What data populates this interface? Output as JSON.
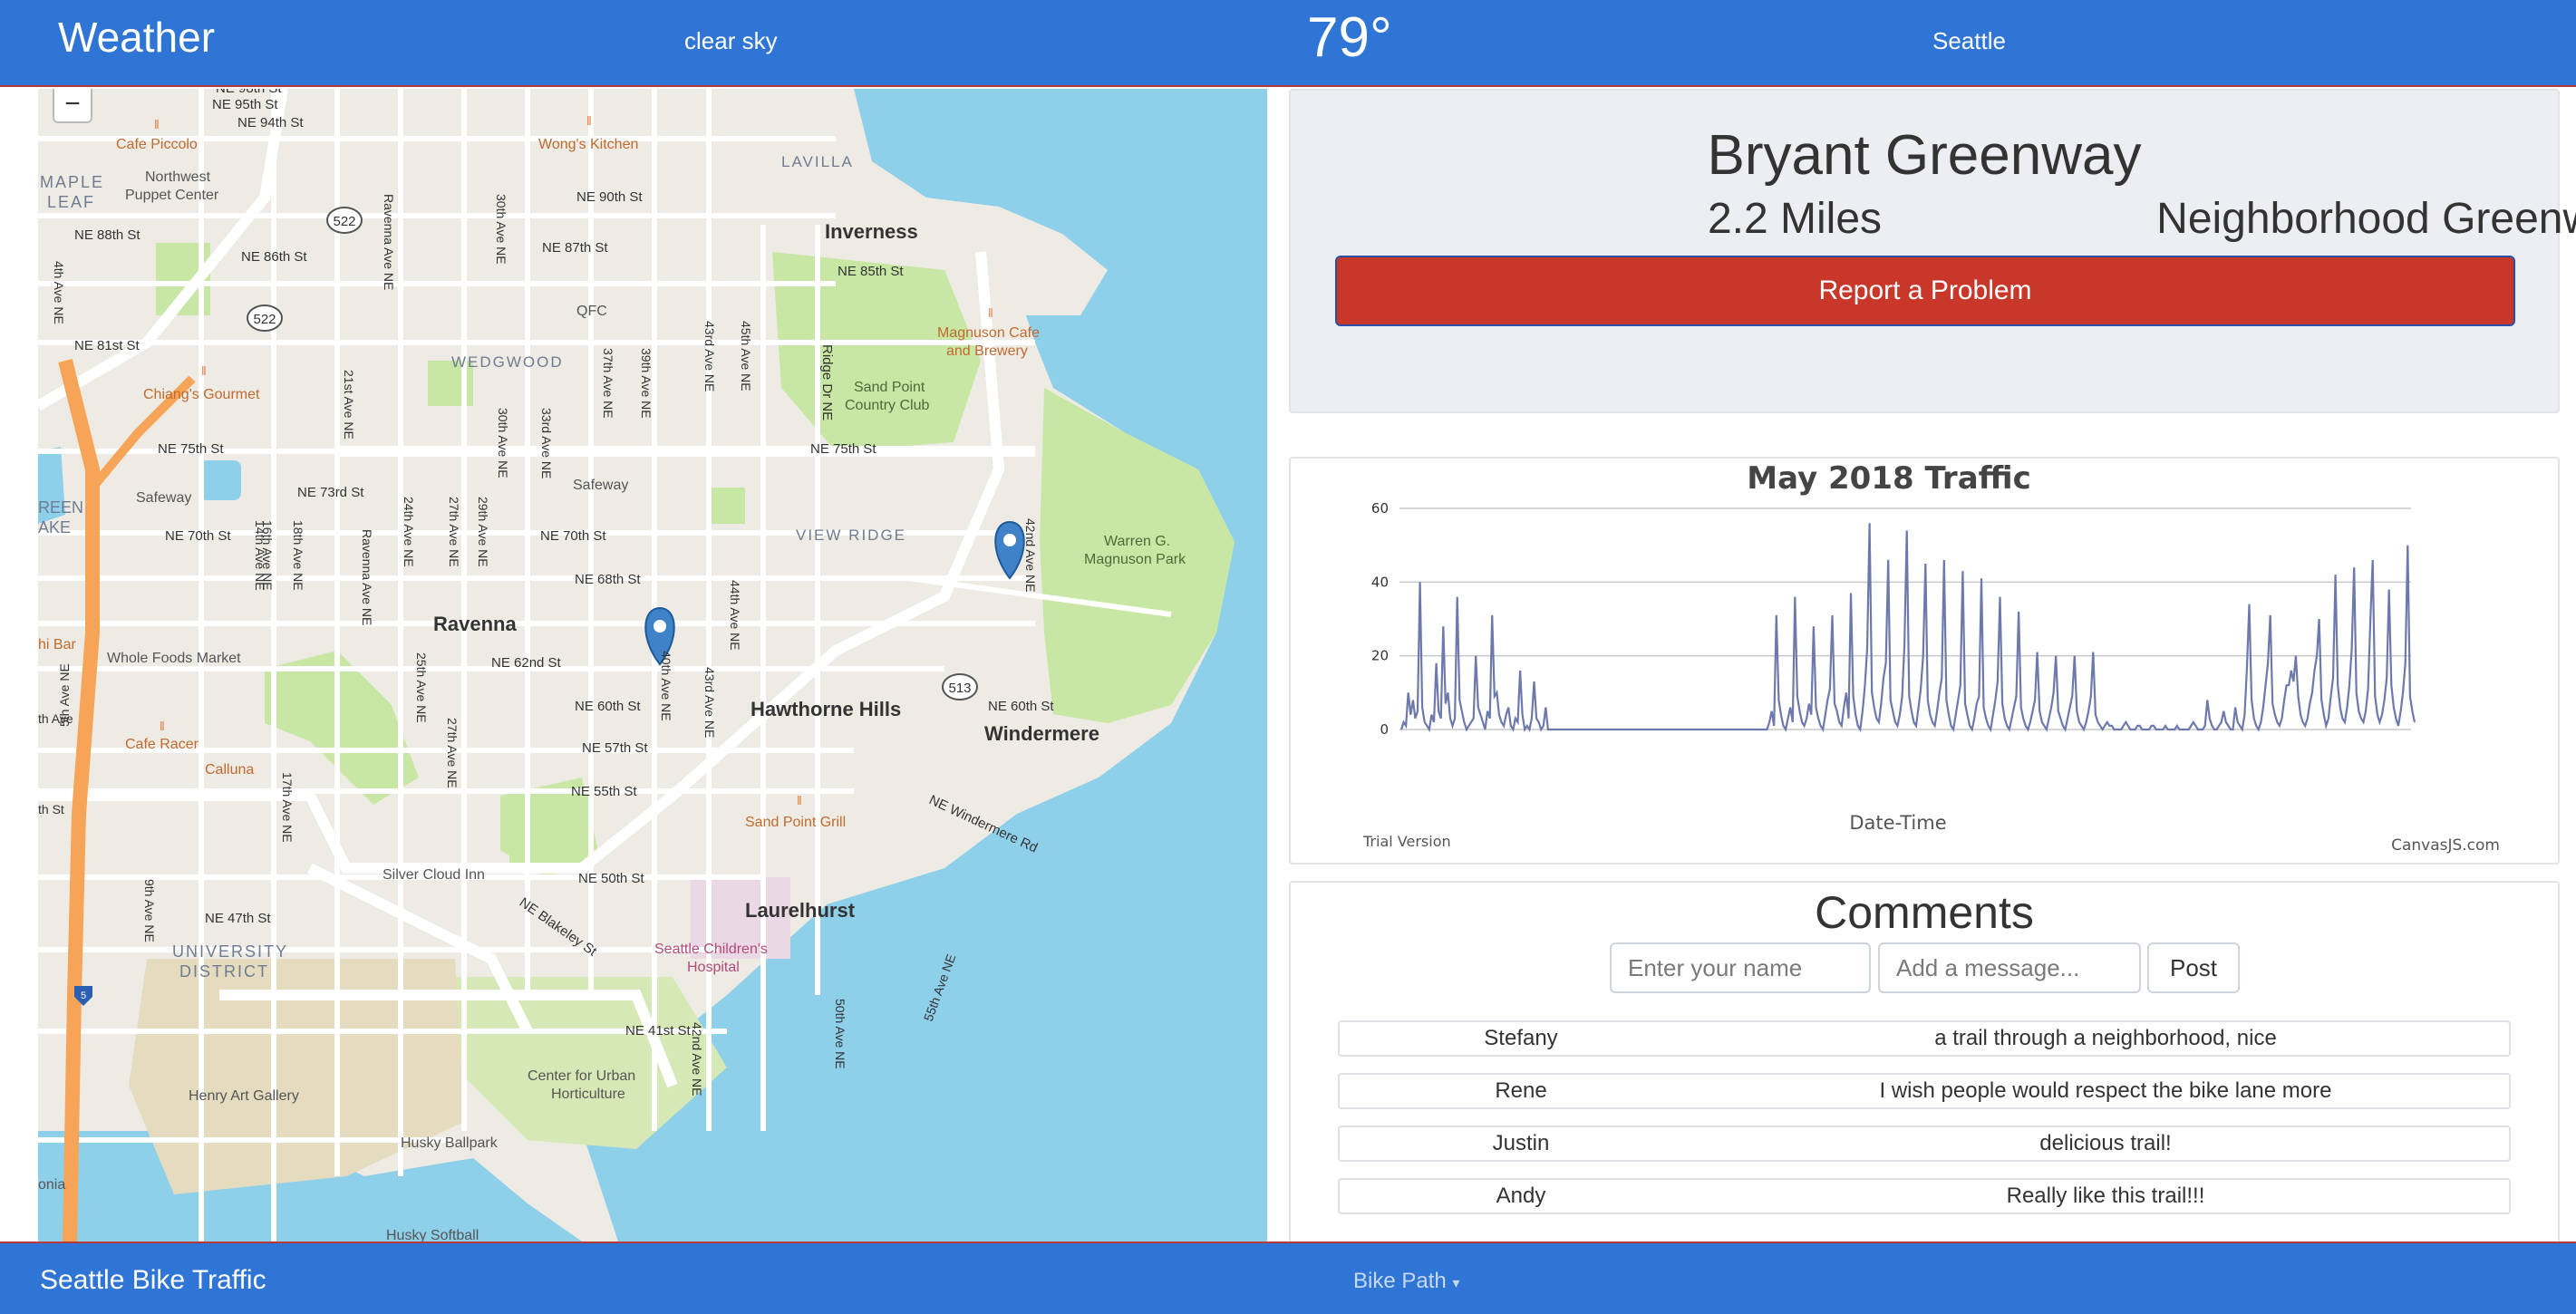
{
  "header": {
    "brand": "Weather",
    "condition": "clear sky",
    "temperature": "79°",
    "city": "Seattle"
  },
  "map": {
    "zoom_out_label": "−",
    "labels": {
      "inverness": "Inverness",
      "ravenna": "Ravenna",
      "hawthorne": "Hawthorne Hills",
      "windermere": "Windermere",
      "laurelhurst": "Laurelhurst",
      "wedgwood": "WEDGWOOD",
      "view_ridge": "VIEW RIDGE",
      "university_district": "UNIVERSITY\nDISTRICT",
      "university_1": "UNIVERSITY",
      "university_2": "DISTRICT",
      "maple_leaf_1": "MAPLE",
      "maple_leaf_2": "LEAF",
      "laville": "LAVILLA",
      "green_lake_1": "REEN",
      "green_lake_2": "AKE",
      "sand_point_1": "Sand Point",
      "sand_point_2": "Country Club",
      "magnuson_1": "Warren G.",
      "magnuson_2": "Magnuson Park",
      "magnuson_cafe_1": "Magnuson Cafe",
      "magnuson_cafe_2": "and Brewery",
      "wongs": "Wong's Kitchen",
      "cafe_piccolo": "Cafe Piccolo",
      "northwest_puppet_1": "Northwest",
      "northwest_puppet_2": "Puppet Center",
      "chiangs": "Chiang's Gourmet",
      "safeway1": "Safeway",
      "safeway2": "Safeway",
      "qfc": "QFC",
      "whole_foods": "Whole Foods Market",
      "cafe_racer": "Cafe Racer",
      "calluna": "Calluna",
      "sand_point_grill": "Sand Point Grill",
      "silver_cloud": "Silver Cloud Inn",
      "childrens_1": "Seattle Children's",
      "childrens_2": "Hospital",
      "urban_hort_1": "Center for Urban",
      "urban_hort_2": "Horticulture",
      "henry_art": "Henry Art Gallery",
      "husky_ballpark": "Husky Ballpark",
      "husky_softball": "Husky Softball",
      "hi_bar": "hi Bar",
      "onia": "onia",
      "ne98": "NE 98th St",
      "ne95": "NE 95th St",
      "ne94": "NE 94th St",
      "ne90": "NE 90th St",
      "ne88": "NE 88th St",
      "ne87": "NE 87th St",
      "ne86": "NE 86th St",
      "ne85": "NE 85th St",
      "ne81": "NE 81st St",
      "ne75a": "NE 75th St",
      "ne75b": "NE 75th St",
      "ne73": "NE 73rd St",
      "ne70a": "NE 70th St",
      "ne70b": "NE 70th St",
      "ne68": "NE 68th St",
      "ne62": "NE 62nd St",
      "ne60a": "NE 60th St",
      "ne60b": "NE 60th St",
      "ne57": "NE 57th St",
      "ne55": "NE 55th St",
      "ne50": "NE 50th St",
      "ne47": "NE 47th St",
      "ne41": "NE 41st St",
      "blakeley": "NE Blakeley St",
      "windermere_rd": "NE Windermere Rd",
      "ridge_dr": "Ridge Dr NE",
      "ave_4": "4th Ave NE",
      "ave_5": "5th Ave NE",
      "ave_9": "9th Ave NE",
      "ave_14": "14th Ave NE",
      "ave_16": "16th Ave NE",
      "ave_17": "17th Ave NE",
      "ave_18": "18th Ave NE",
      "ave_21": "21st Ave NE",
      "ave_24": "24th Ave NE",
      "ave_25": "25th Ave NE",
      "ave_27a": "27th Ave NE",
      "ave_27b": "27th Ave NE",
      "ave_29": "29th Ave NE",
      "ave_30a": "30th Ave NE",
      "ave_30b": "30th Ave NE",
      "ave_33": "33rd Ave NE",
      "ave_37": "37th Ave NE",
      "ave_39": "39th Ave NE",
      "ave_40": "40th Ave NE",
      "ave_42a": "42nd Ave NE",
      "ave_42b": "42nd Ave NE",
      "ave_43a": "43rd Ave NE",
      "ave_43b": "43rd Ave NE",
      "ave_44": "44th Ave NE",
      "ave_45": "45th Ave NE",
      "ave_50": "50th Ave NE",
      "ave_55": "55th Ave NE",
      "ravenna_ave_a": "Ravenna Ave NE",
      "ravenna_ave_b": "Ravenna Ave NE",
      "ave_th": "th Ave",
      "th_st": "th St",
      "sh_522a": "522",
      "sh_522b": "522",
      "sh_513": "513",
      "i5": "5"
    }
  },
  "trail": {
    "name": "Bryant Greenway",
    "miles": "2.2 Miles",
    "type": "Neighborhood Greenway",
    "report_button": "Report a Problem"
  },
  "chart_data": {
    "type": "line",
    "title": "May 2018 Traffic",
    "xlabel": "Date-Time",
    "ylabel": "",
    "ylim": [
      0,
      60
    ],
    "yticks": [
      0,
      20,
      40,
      60
    ],
    "grid": true,
    "watermark_left": "Trial Version",
    "watermark_right": "CanvasJS.com",
    "series": [
      {
        "color": "#6d78ad",
        "values": [
          0,
          2,
          1,
          10,
          4,
          8,
          3,
          5,
          40,
          6,
          2,
          1,
          0,
          4,
          2,
          18,
          5,
          3,
          28,
          7,
          10,
          3,
          1,
          3,
          36,
          8,
          5,
          2,
          0,
          1,
          2,
          3,
          20,
          6,
          4,
          2,
          0,
          5,
          3,
          31,
          9,
          10,
          4,
          2,
          1,
          4,
          6,
          1,
          0,
          3,
          2,
          16,
          4,
          0,
          1,
          0,
          3,
          13,
          3,
          2,
          0,
          1,
          6,
          0,
          0,
          0,
          0,
          0,
          0,
          0,
          0,
          0,
          0,
          0,
          0,
          0,
          0,
          0,
          0,
          0,
          0,
          0,
          0,
          0,
          0,
          0,
          0,
          0,
          0,
          0,
          0,
          0,
          0,
          0,
          0,
          0,
          0,
          0,
          0,
          0,
          0,
          0,
          0,
          0,
          0,
          0,
          0,
          0,
          0,
          0,
          0,
          0,
          0,
          0,
          0,
          0,
          0,
          0,
          0,
          0,
          0,
          0,
          0,
          0,
          0,
          0,
          0,
          0,
          0,
          0,
          0,
          0,
          0,
          0,
          0,
          0,
          0,
          0,
          0,
          0,
          0,
          0,
          0,
          0,
          0,
          0,
          0,
          0,
          0,
          0,
          0,
          0,
          0,
          0,
          0,
          0,
          0,
          0,
          2,
          5,
          1,
          31,
          8,
          4,
          1,
          0,
          3,
          6,
          2,
          36,
          9,
          5,
          2,
          1,
          3,
          7,
          4,
          28,
          6,
          3,
          1,
          0,
          4,
          8,
          11,
          31,
          7,
          5,
          2,
          1,
          6,
          10,
          3,
          37,
          9,
          4,
          1,
          0,
          5,
          12,
          22,
          56,
          10,
          6,
          3,
          2,
          7,
          14,
          18,
          46,
          8,
          5,
          2,
          1,
          4,
          9,
          23,
          54,
          9,
          5,
          2,
          1,
          6,
          11,
          20,
          45,
          8,
          4,
          2,
          1,
          5,
          10,
          14,
          46,
          8,
          4,
          1,
          0,
          4,
          8,
          12,
          43,
          7,
          4,
          1,
          0,
          3,
          7,
          9,
          41,
          6,
          3,
          1,
          0,
          4,
          8,
          13,
          36,
          7,
          3,
          1,
          0,
          3,
          6,
          9,
          32,
          6,
          3,
          1,
          0,
          2,
          5,
          8,
          21,
          5,
          2,
          1,
          0,
          3,
          6,
          10,
          20,
          5,
          3,
          1,
          0,
          3,
          6,
          9,
          20,
          5,
          2,
          1,
          0,
          2,
          5,
          9,
          21,
          4,
          2,
          1,
          0,
          1,
          2,
          1,
          1,
          0,
          0,
          0,
          0,
          1,
          2,
          1,
          0,
          0,
          0,
          1,
          1,
          0,
          0,
          0,
          0,
          1,
          1,
          0,
          0,
          0,
          0,
          1,
          0,
          0,
          0,
          0,
          1,
          0,
          0,
          0,
          0,
          0,
          1,
          2,
          1,
          0,
          0,
          0,
          1,
          8,
          3,
          1,
          0,
          0,
          1,
          2,
          5,
          2,
          1,
          0,
          0,
          6,
          2,
          1,
          0,
          4,
          17,
          34,
          8,
          3,
          1,
          0,
          2,
          6,
          12,
          18,
          31,
          7,
          4,
          2,
          1,
          3,
          8,
          12,
          12,
          16,
          13,
          20,
          9,
          4,
          2,
          1,
          3,
          7,
          10,
          16,
          20,
          30,
          8,
          4,
          1,
          3,
          9,
          14,
          42,
          12,
          6,
          3,
          2,
          6,
          12,
          22,
          44,
          10,
          5,
          3,
          2,
          5,
          11,
          30,
          46,
          9,
          4,
          2,
          4,
          8,
          14,
          38,
          12,
          6,
          3,
          1,
          5,
          10,
          18,
          50,
          9,
          5,
          2
        ]
      }
    ]
  },
  "comments": {
    "title": "Comments",
    "name_placeholder": "Enter your name",
    "message_placeholder": "Add a message...",
    "post_button": "Post",
    "items": [
      {
        "author": "Stefany",
        "message": "a trail through a neighborhood, nice"
      },
      {
        "author": "Rene",
        "message": "I wish people would respect the bike lane more"
      },
      {
        "author": "Justin",
        "message": "delicious trail!"
      },
      {
        "author": "Andy",
        "message": "Really like this trail!!!"
      }
    ]
  },
  "footer": {
    "title": "Seattle Bike Traffic",
    "menu": "Bike Path",
    "menu_caret": "▾"
  },
  "colors": {
    "navbar": "#2f75d6",
    "report_button": "#c9372a",
    "water": "#8ecfea",
    "park": "#c8e6a4",
    "highway": "#f6a457",
    "marker": "#3f82c8",
    "series": "#6d78ad"
  }
}
